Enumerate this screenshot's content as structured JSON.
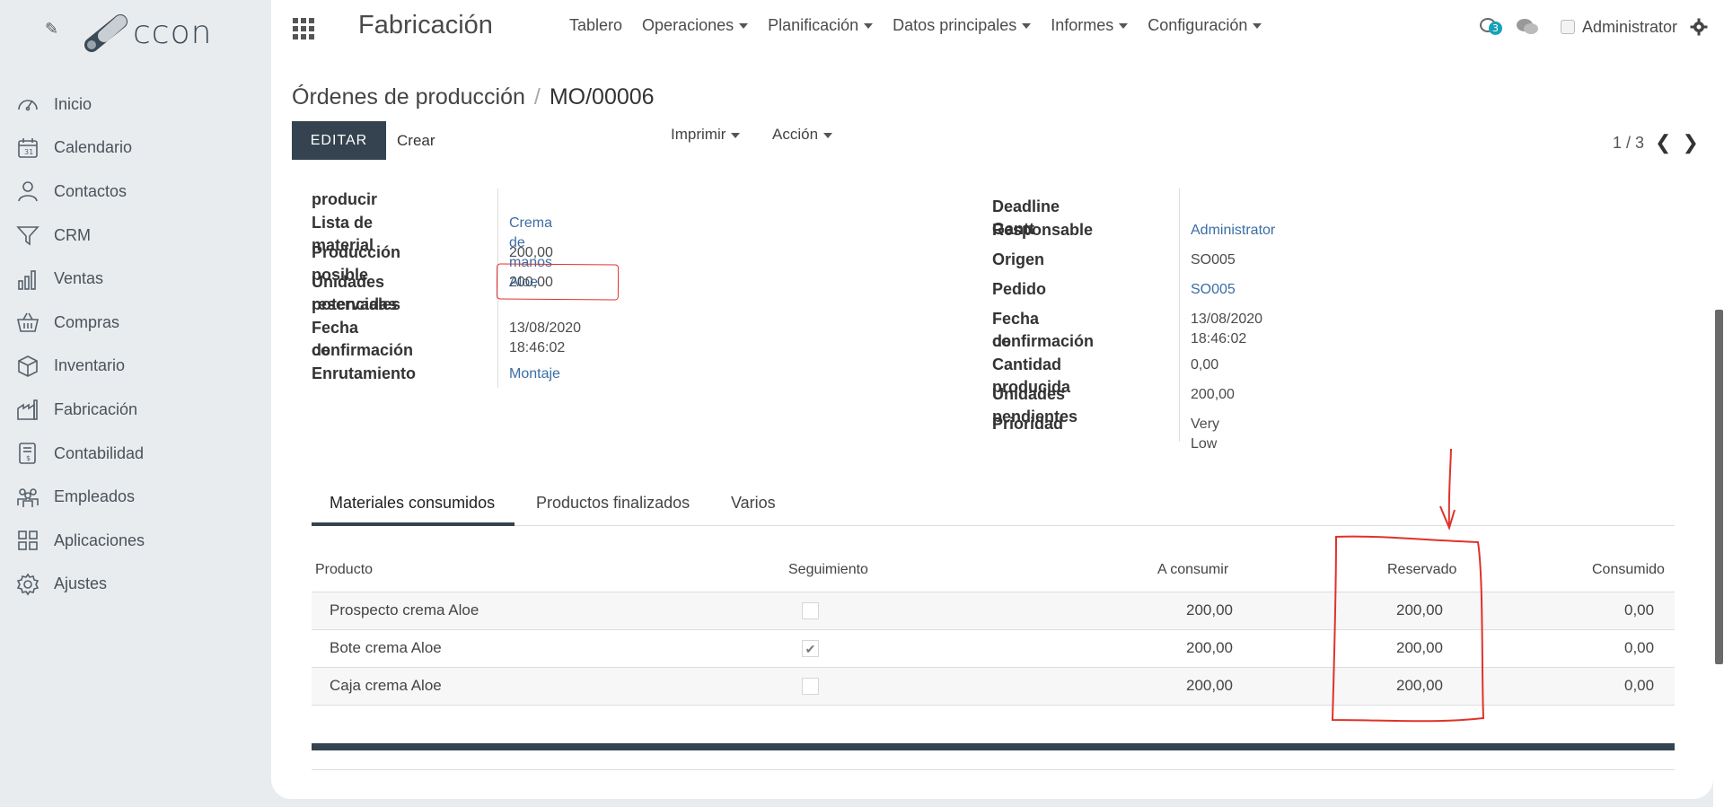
{
  "brand": {
    "text": "ccon"
  },
  "sidebar": {
    "items": [
      {
        "label": "Inicio",
        "icon": "dashboard-icon"
      },
      {
        "label": "Calendario",
        "icon": "calendar-icon"
      },
      {
        "label": "Contactos",
        "icon": "user-icon"
      },
      {
        "label": "CRM",
        "icon": "filter-icon"
      },
      {
        "label": "Ventas",
        "icon": "bar-chart-icon"
      },
      {
        "label": "Compras",
        "icon": "basket-icon"
      },
      {
        "label": "Inventario",
        "icon": "box-icon"
      },
      {
        "label": "Fabricación",
        "icon": "factory-icon"
      },
      {
        "label": "Contabilidad",
        "icon": "invoice-icon"
      },
      {
        "label": "Empleados",
        "icon": "people-icon"
      },
      {
        "label": "Aplicaciones",
        "icon": "apps-grid-icon"
      },
      {
        "label": "Ajustes",
        "icon": "gear-icon"
      }
    ]
  },
  "topbar": {
    "app_title": "Fabricación",
    "nav": [
      "Tablero",
      "Operaciones",
      "Planificación",
      "Datos principales",
      "Informes",
      "Configuración"
    ],
    "badge_count": "3",
    "user": "Administrator"
  },
  "control": {
    "breadcrumb_parent": "Órdenes de producción",
    "breadcrumb_sep": "/",
    "breadcrumb_current": "MO/00006",
    "edit_label": "EDITAR",
    "create_label": "Crear",
    "print_label": "Imprimir",
    "action_label": "Acción",
    "pager": "1 / 3"
  },
  "form_left": {
    "cut_label": "producir",
    "bom_label": "Lista de material",
    "bom_value": "Crema de manos Aloe",
    "possible_label": "Producción posible",
    "possible_value": "200,00",
    "reserved_label_1": "Unidades potenciales",
    "reserved_label_2": "reservadas",
    "reserved_value": "200,00",
    "confirm_label_1": "Fecha de",
    "confirm_label_2": "confirmación",
    "confirm_value": "13/08/2020 18:46:02",
    "routing_label": "Enrutamiento",
    "routing_value": "Montaje"
  },
  "form_right": {
    "gantt_label": "Deadline Gantt",
    "responsible_label": "Responsable",
    "responsible_value": "Administrator",
    "origin_label": "Origen",
    "origin_value": "SO005",
    "order_label": "Pedido",
    "order_value": "SO005",
    "confirm_label_1": "Fecha de",
    "confirm_label_2": "confirmación",
    "confirm_value": "13/08/2020 18:46:02",
    "produced_label": "Cantidad producida",
    "produced_value": "0,00",
    "pending_label": "Unidades pendientes",
    "pending_value": "200,00",
    "priority_label": "Prioridad",
    "priority_value": "Very Low"
  },
  "tabs": [
    "Materiales consumidos",
    "Productos finalizados",
    "Varios"
  ],
  "table": {
    "headers": [
      "Producto",
      "Seguimiento",
      "A consumir",
      "Reservado",
      "Consumido"
    ],
    "rows": [
      {
        "product": "Prospecto crema Aloe",
        "tracked": false,
        "to_consume": "200,00",
        "reserved": "200,00",
        "consumed": "0,00"
      },
      {
        "product": "Bote crema Aloe",
        "tracked": true,
        "to_consume": "200,00",
        "reserved": "200,00",
        "consumed": "0,00"
      },
      {
        "product": "Caja crema Aloe",
        "tracked": false,
        "to_consume": "200,00",
        "reserved": "200,00",
        "consumed": "0,00"
      }
    ]
  },
  "colors": {
    "accent": "#34434f",
    "link": "#3a6ea5",
    "annotation": "#e0322a",
    "badge": "#17a2b8"
  }
}
